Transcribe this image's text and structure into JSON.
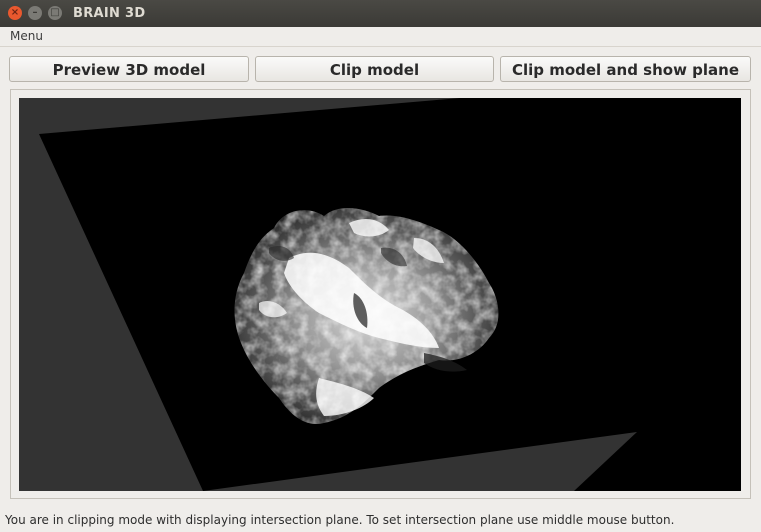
{
  "window": {
    "title": "BRAIN 3D"
  },
  "menubar": {
    "menu_label": "Menu"
  },
  "toolbar": {
    "preview_label": "Preview 3D model",
    "clip_label": "Clip model",
    "clip_show_plane_label": "Clip model and show plane"
  },
  "status": {
    "message": "You are in clipping mode with displaying intersection plane. To set intersection plane  use middle mouse button."
  },
  "colors": {
    "viewport_background": "#333333",
    "slice_plane": "#000000"
  },
  "icons": [
    "close-icon",
    "minimize-icon",
    "maximize-icon"
  ]
}
